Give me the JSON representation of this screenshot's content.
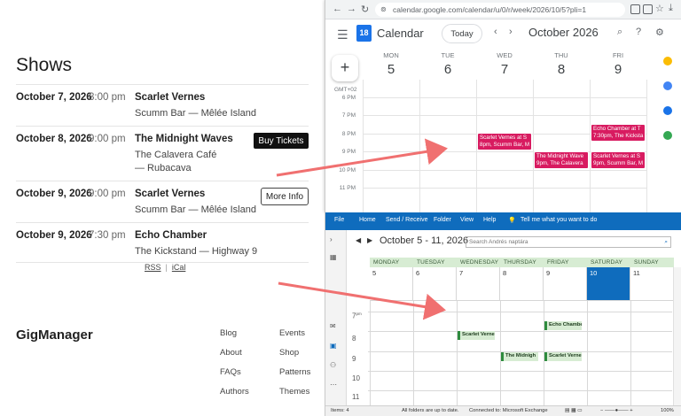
{
  "site": {
    "title": "Shows",
    "shows": [
      {
        "date": "October 7, 2026",
        "time": "8:00 pm",
        "band": "Scarlet Vernes",
        "venue": "Scumm Bar — Mêlée Island",
        "button": ""
      },
      {
        "date": "October 8, 2026",
        "time": "9:00 pm",
        "band": "The Midnight Waves",
        "venue": "The Calavera Café — Rubacava",
        "button": "Buy Tickets"
      },
      {
        "date": "October 9, 2026",
        "time": "9:00 pm",
        "band": "Scarlet Vernes",
        "venue": "Scumm Bar — Mêlée Island",
        "button": "More Info"
      },
      {
        "date": "October 9, 2026",
        "time": "7:30 pm",
        "band": "Echo Chamber",
        "venue": "The Kickstand — Highway 9",
        "button": ""
      }
    ],
    "feeds": {
      "rss": "RSS",
      "separator": "|",
      "ical": "iCal"
    },
    "brand": "GigManager",
    "footer_links": [
      "Blog",
      "Events",
      "About",
      "Shop",
      "FAQs",
      "Patterns",
      "Authors",
      "Themes"
    ]
  },
  "gcal": {
    "url": "calendar.google.com/calendar/u/0/r/week/2026/10/5?pli=1",
    "app_name": "Calendar",
    "logo_day": "18",
    "today_label": "Today",
    "month_label": "October 2026",
    "create_label": "+",
    "timezone": "GMT+02",
    "days": [
      {
        "dow": "MON",
        "num": "5"
      },
      {
        "dow": "TUE",
        "num": "6"
      },
      {
        "dow": "WED",
        "num": "7"
      },
      {
        "dow": "THU",
        "num": "8"
      },
      {
        "dow": "FRI",
        "num": "9"
      }
    ],
    "hours": [
      "6 PM",
      "7 PM",
      "8 PM",
      "9 PM",
      "10 PM",
      "11 PM"
    ],
    "events": [
      {
        "line1": "Scarlet Vernes at S",
        "line2": "8pm, Scumm Bar, M"
      },
      {
        "line1": "The Midnight Wave",
        "line2": "9pm, The Calavera"
      },
      {
        "line1": "Echo Chamber at T",
        "line2": "7:30pm, The Kicksta"
      },
      {
        "line1": "Scarlet Vernes at S",
        "line2": "9pm, Scumm Bar, M"
      }
    ],
    "event_color": "#d81b60"
  },
  "outlook": {
    "tabs": [
      "File",
      "Home",
      "Send / Receive",
      "Folder",
      "View",
      "Help",
      "Tell me what you want to do"
    ],
    "date_range": "October 5 - 11, 2026",
    "search_placeholder": "Search Andrés naptára",
    "days": [
      "MONDAY",
      "TUESDAY",
      "WEDNESDAY",
      "THURSDAY",
      "FRIDAY",
      "SATURDAY",
      "SUNDAY"
    ],
    "dates": [
      "5",
      "6",
      "7",
      "8",
      "9",
      "10",
      "11"
    ],
    "hours": [
      "7",
      "8",
      "9",
      "10",
      "11"
    ],
    "hour_suffix": "pm",
    "events": [
      {
        "label": "Echo Chambe"
      },
      {
        "label": "Scarlet Verne"
      },
      {
        "label": "The Midnigh"
      },
      {
        "label": "Scarlet Verne"
      }
    ],
    "status": {
      "items": "Items: 4",
      "sync": "All folders are up to date.",
      "connection": "Connected to: Microsoft Exchange",
      "zoom": "100%"
    },
    "accent": "#0f6cbd",
    "event_color": "#d7ecd3"
  }
}
